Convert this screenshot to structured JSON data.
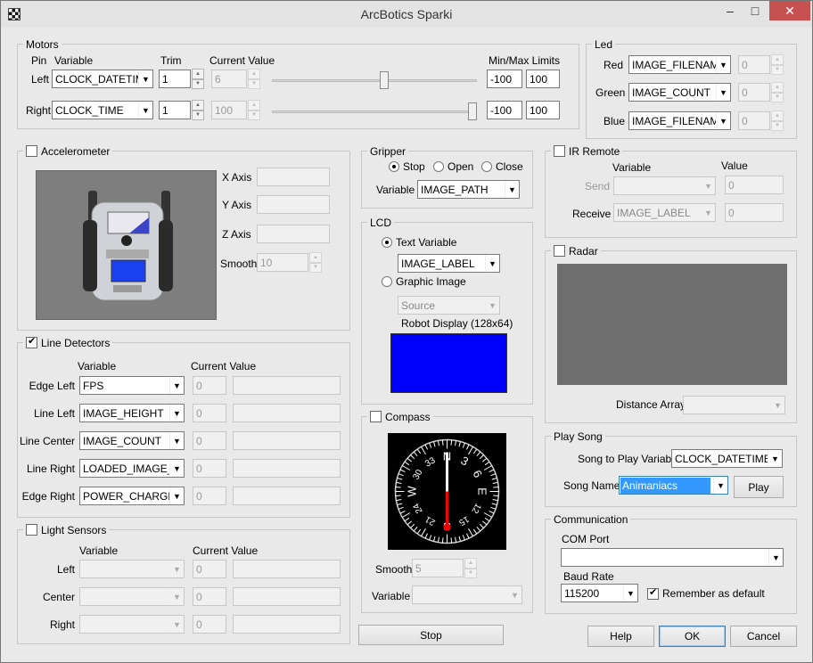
{
  "window": {
    "title": "ArcBotics Sparki",
    "minimize": "–",
    "maximize": "□",
    "close": "✕"
  },
  "motors": {
    "title": "Motors",
    "pin_header": "Pin",
    "variable_header": "Variable",
    "trim_header": "Trim",
    "current_header": "Current Value",
    "limits_header": "Min/Max Limits",
    "left": {
      "pin": "Left",
      "variable": "CLOCK_DATETIME",
      "trim": "1",
      "current": "6",
      "min": "-100",
      "max": "100",
      "slider": 0.55
    },
    "right": {
      "pin": "Right",
      "variable": "CLOCK_TIME",
      "trim": "1",
      "current": "100",
      "min": "-100",
      "max": "100",
      "slider": 1.0
    }
  },
  "led": {
    "title": "Led",
    "red_label": "Red",
    "red_var": "IMAGE_FILENAME",
    "red_val": "0",
    "green_label": "Green",
    "green_var": "IMAGE_COUNT",
    "green_val": "0",
    "blue_label": "Blue",
    "blue_var": "IMAGE_FILENAME",
    "blue_val": "0"
  },
  "accelerometer": {
    "title": "Accelerometer",
    "enabled": false,
    "x_label": "X Axis",
    "y_label": "Y Axis",
    "z_label": "Z Axis",
    "smooth_label": "Smooth",
    "smooth": "10"
  },
  "gripper": {
    "title": "Gripper",
    "stop": "Stop",
    "open": "Open",
    "close": "Close",
    "selected": "Stop",
    "variable_label": "Variable",
    "variable": "IMAGE_PATH"
  },
  "ir_remote": {
    "title": "IR Remote",
    "enabled": false,
    "variable_header": "Variable",
    "value_header": "Value",
    "send_label": "Send",
    "send_var": "",
    "send_val": "0",
    "receive_label": "Receive",
    "receive_var": "IMAGE_LABEL",
    "receive_val": "0"
  },
  "lcd": {
    "title": "LCD",
    "text_variable": "Text Variable",
    "text_var_value": "IMAGE_LABEL",
    "graphic_image": "Graphic Image",
    "source": "Source",
    "display_label": "Robot Display (128x64)",
    "display_color": "#0000ff"
  },
  "radar": {
    "title": "Radar",
    "enabled": false,
    "distance_label": "Distance Array",
    "distance": ""
  },
  "line_detectors": {
    "title": "Line Detectors",
    "enabled": true,
    "variable_header": "Variable",
    "current_header": "Current Value",
    "rows": [
      {
        "label": "Edge Left",
        "variable": "FPS",
        "value": "0"
      },
      {
        "label": "Line Left",
        "variable": "IMAGE_HEIGHT",
        "value": "0"
      },
      {
        "label": "Line Center",
        "variable": "IMAGE_COUNT",
        "value": "0"
      },
      {
        "label": "Line Right",
        "variable": "LOADED_IMAGE_S",
        "value": "0"
      },
      {
        "label": "Edge Right",
        "variable": "POWER_CHARGE",
        "value": "0"
      }
    ]
  },
  "compass": {
    "title": "Compass",
    "enabled": false,
    "smooth_label": "Smooth",
    "smooth": "5",
    "variable_label": "Variable",
    "variable": "",
    "dial_labels": [
      "N",
      "3",
      "6",
      "E",
      "12",
      "15",
      "S",
      "21",
      "24",
      "W",
      "30",
      "33"
    ]
  },
  "play_song": {
    "title": "Play Song",
    "song_var_label": "Song to Play Variable",
    "song_var": "CLOCK_DATETIME",
    "song_name_label": "Song Name",
    "song_name": "Animaniacs",
    "play": "Play"
  },
  "light_sensors": {
    "title": "Light Sensors",
    "enabled": false,
    "variable_header": "Variable",
    "current_header": "Current Value",
    "rows": [
      {
        "label": "Left",
        "variable": "",
        "value": "0"
      },
      {
        "label": "Center",
        "variable": "",
        "value": "0"
      },
      {
        "label": "Right",
        "variable": "",
        "value": "0"
      }
    ]
  },
  "communication": {
    "title": "Communication",
    "com_port_label": "COM Port",
    "com_port": "",
    "baud_rate_label": "Baud Rate",
    "baud_rate": "115200",
    "remember": "Remember as default",
    "remember_checked": true
  },
  "buttons": {
    "stop": "Stop",
    "help": "Help",
    "ok": "OK",
    "cancel": "Cancel"
  }
}
